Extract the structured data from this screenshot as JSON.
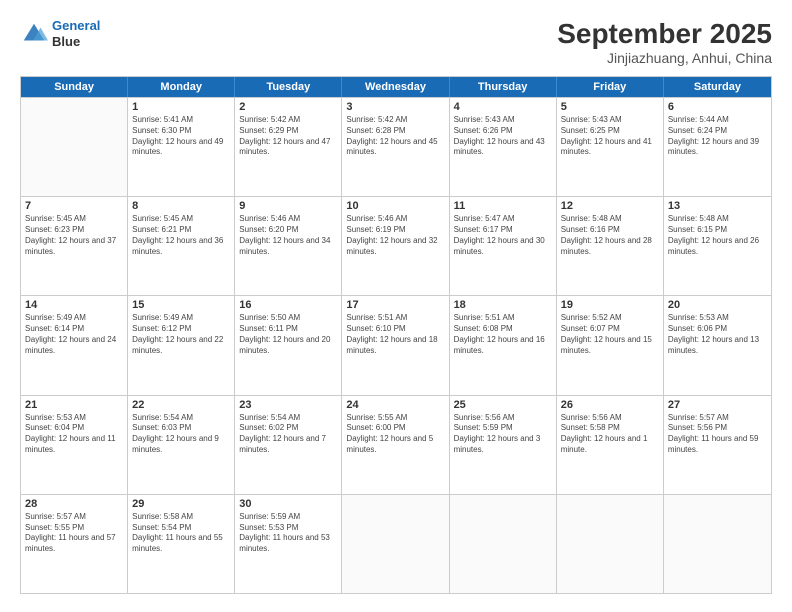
{
  "logo": {
    "line1": "General",
    "line2": "Blue"
  },
  "title": "September 2025",
  "subtitle": "Jinjiazhuang, Anhui, China",
  "days": [
    "Sunday",
    "Monday",
    "Tuesday",
    "Wednesday",
    "Thursday",
    "Friday",
    "Saturday"
  ],
  "weeks": [
    [
      {
        "day": "",
        "empty": true
      },
      {
        "day": "1",
        "sunrise": "Sunrise: 5:41 AM",
        "sunset": "Sunset: 6:30 PM",
        "daylight": "Daylight: 12 hours and 49 minutes."
      },
      {
        "day": "2",
        "sunrise": "Sunrise: 5:42 AM",
        "sunset": "Sunset: 6:29 PM",
        "daylight": "Daylight: 12 hours and 47 minutes."
      },
      {
        "day": "3",
        "sunrise": "Sunrise: 5:42 AM",
        "sunset": "Sunset: 6:28 PM",
        "daylight": "Daylight: 12 hours and 45 minutes."
      },
      {
        "day": "4",
        "sunrise": "Sunrise: 5:43 AM",
        "sunset": "Sunset: 6:26 PM",
        "daylight": "Daylight: 12 hours and 43 minutes."
      },
      {
        "day": "5",
        "sunrise": "Sunrise: 5:43 AM",
        "sunset": "Sunset: 6:25 PM",
        "daylight": "Daylight: 12 hours and 41 minutes."
      },
      {
        "day": "6",
        "sunrise": "Sunrise: 5:44 AM",
        "sunset": "Sunset: 6:24 PM",
        "daylight": "Daylight: 12 hours and 39 minutes."
      }
    ],
    [
      {
        "day": "7",
        "sunrise": "Sunrise: 5:45 AM",
        "sunset": "Sunset: 6:23 PM",
        "daylight": "Daylight: 12 hours and 37 minutes."
      },
      {
        "day": "8",
        "sunrise": "Sunrise: 5:45 AM",
        "sunset": "Sunset: 6:21 PM",
        "daylight": "Daylight: 12 hours and 36 minutes."
      },
      {
        "day": "9",
        "sunrise": "Sunrise: 5:46 AM",
        "sunset": "Sunset: 6:20 PM",
        "daylight": "Daylight: 12 hours and 34 minutes."
      },
      {
        "day": "10",
        "sunrise": "Sunrise: 5:46 AM",
        "sunset": "Sunset: 6:19 PM",
        "daylight": "Daylight: 12 hours and 32 minutes."
      },
      {
        "day": "11",
        "sunrise": "Sunrise: 5:47 AM",
        "sunset": "Sunset: 6:17 PM",
        "daylight": "Daylight: 12 hours and 30 minutes."
      },
      {
        "day": "12",
        "sunrise": "Sunrise: 5:48 AM",
        "sunset": "Sunset: 6:16 PM",
        "daylight": "Daylight: 12 hours and 28 minutes."
      },
      {
        "day": "13",
        "sunrise": "Sunrise: 5:48 AM",
        "sunset": "Sunset: 6:15 PM",
        "daylight": "Daylight: 12 hours and 26 minutes."
      }
    ],
    [
      {
        "day": "14",
        "sunrise": "Sunrise: 5:49 AM",
        "sunset": "Sunset: 6:14 PM",
        "daylight": "Daylight: 12 hours and 24 minutes."
      },
      {
        "day": "15",
        "sunrise": "Sunrise: 5:49 AM",
        "sunset": "Sunset: 6:12 PM",
        "daylight": "Daylight: 12 hours and 22 minutes."
      },
      {
        "day": "16",
        "sunrise": "Sunrise: 5:50 AM",
        "sunset": "Sunset: 6:11 PM",
        "daylight": "Daylight: 12 hours and 20 minutes."
      },
      {
        "day": "17",
        "sunrise": "Sunrise: 5:51 AM",
        "sunset": "Sunset: 6:10 PM",
        "daylight": "Daylight: 12 hours and 18 minutes."
      },
      {
        "day": "18",
        "sunrise": "Sunrise: 5:51 AM",
        "sunset": "Sunset: 6:08 PM",
        "daylight": "Daylight: 12 hours and 16 minutes."
      },
      {
        "day": "19",
        "sunrise": "Sunrise: 5:52 AM",
        "sunset": "Sunset: 6:07 PM",
        "daylight": "Daylight: 12 hours and 15 minutes."
      },
      {
        "day": "20",
        "sunrise": "Sunrise: 5:53 AM",
        "sunset": "Sunset: 6:06 PM",
        "daylight": "Daylight: 12 hours and 13 minutes."
      }
    ],
    [
      {
        "day": "21",
        "sunrise": "Sunrise: 5:53 AM",
        "sunset": "Sunset: 6:04 PM",
        "daylight": "Daylight: 12 hours and 11 minutes."
      },
      {
        "day": "22",
        "sunrise": "Sunrise: 5:54 AM",
        "sunset": "Sunset: 6:03 PM",
        "daylight": "Daylight: 12 hours and 9 minutes."
      },
      {
        "day": "23",
        "sunrise": "Sunrise: 5:54 AM",
        "sunset": "Sunset: 6:02 PM",
        "daylight": "Daylight: 12 hours and 7 minutes."
      },
      {
        "day": "24",
        "sunrise": "Sunrise: 5:55 AM",
        "sunset": "Sunset: 6:00 PM",
        "daylight": "Daylight: 12 hours and 5 minutes."
      },
      {
        "day": "25",
        "sunrise": "Sunrise: 5:56 AM",
        "sunset": "Sunset: 5:59 PM",
        "daylight": "Daylight: 12 hours and 3 minutes."
      },
      {
        "day": "26",
        "sunrise": "Sunrise: 5:56 AM",
        "sunset": "Sunset: 5:58 PM",
        "daylight": "Daylight: 12 hours and 1 minute."
      },
      {
        "day": "27",
        "sunrise": "Sunrise: 5:57 AM",
        "sunset": "Sunset: 5:56 PM",
        "daylight": "Daylight: 11 hours and 59 minutes."
      }
    ],
    [
      {
        "day": "28",
        "sunrise": "Sunrise: 5:57 AM",
        "sunset": "Sunset: 5:55 PM",
        "daylight": "Daylight: 11 hours and 57 minutes."
      },
      {
        "day": "29",
        "sunrise": "Sunrise: 5:58 AM",
        "sunset": "Sunset: 5:54 PM",
        "daylight": "Daylight: 11 hours and 55 minutes."
      },
      {
        "day": "30",
        "sunrise": "Sunrise: 5:59 AM",
        "sunset": "Sunset: 5:53 PM",
        "daylight": "Daylight: 11 hours and 53 minutes."
      },
      {
        "day": "",
        "empty": true
      },
      {
        "day": "",
        "empty": true
      },
      {
        "day": "",
        "empty": true
      },
      {
        "day": "",
        "empty": true
      }
    ]
  ]
}
